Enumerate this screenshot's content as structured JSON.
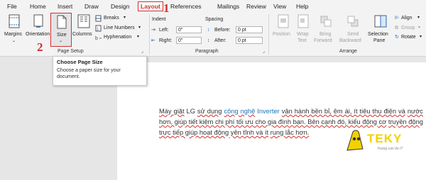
{
  "tabs": [
    "File",
    "Home",
    "Insert",
    "Draw",
    "Design",
    "Layout",
    "References",
    "Mailings",
    "Review",
    "View",
    "Help"
  ],
  "active_tab": "Layout",
  "page_setup": {
    "margins": "Margins",
    "orientation": "Orientation",
    "size": "Size",
    "columns": "Columns",
    "breaks": "Breaks",
    "line_numbers": "Line Numbers",
    "hyphenation": "Hyphenation",
    "group_label": "Page Setup"
  },
  "paragraph": {
    "indent_header": "Indent",
    "spacing_header": "Spacing",
    "left_label": "Left:",
    "right_label": "Right:",
    "before_label": "Before:",
    "after_label": "After:",
    "left_value": "0\"",
    "right_value": "0\"",
    "before_value": "0 pt",
    "after_value": "0 pt",
    "group_label": "Paragraph"
  },
  "arrange": {
    "position": "Position",
    "wrap_text_1": "Wrap",
    "wrap_text_2": "Text",
    "bring_forward_1": "Bring",
    "bring_forward_2": "Forward",
    "send_backward_1": "Send",
    "send_backward_2": "Backward",
    "selection_pane_1": "Selection",
    "selection_pane_2": "Pane",
    "align": "Align",
    "group": "Group",
    "rotate": "Rotate",
    "group_label": "Arrange"
  },
  "annotations": {
    "step1": "1",
    "step2": "2"
  },
  "tooltip": {
    "title": "Choose Page Size",
    "line1": "Choose a paper size for your",
    "line2": "document."
  },
  "document": {
    "line1_a": "Máy giặt",
    "line1_b": "LG",
    "line1_c": "sử dụng",
    "line1_d": "công nghệ",
    "line1_e": "Inverter",
    "line1_f": "vận hành bền bỉ, êm ái, ít tiêu thụ điện và",
    "line2": "nước hơn, giúp tiết kiệm chi phí tối ưu cho gia đình bạn. Bên cạnh đó, kiểu động cơ",
    "line3_a": "truyền động trực tiếp giúp hoạt động yên tĩnh và ít",
    "line3_b": "rung lắc hơn."
  },
  "logo": {
    "brand": "TEKY",
    "tagline": "Young can do IT"
  },
  "colors": {
    "annotation_red": "#d32f2f",
    "link_blue": "#1a73b8",
    "logo_yellow": "#f2d100"
  }
}
